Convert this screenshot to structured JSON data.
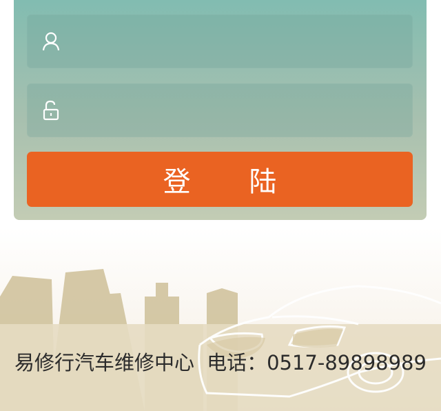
{
  "login": {
    "username_placeholder": "",
    "password_placeholder": "",
    "submit_label": "登 陆"
  },
  "footer": {
    "company": "易修行汽车维修中心",
    "phone_label": "电话：",
    "phone_number": "0517-89898989"
  },
  "colors": {
    "panel_top": "#7fbcb1",
    "panel_bottom": "#c3ccb4",
    "button": "#ea6322",
    "scene": "#d6c8a4"
  },
  "icons": {
    "username": "user-icon",
    "password": "lock-icon"
  }
}
